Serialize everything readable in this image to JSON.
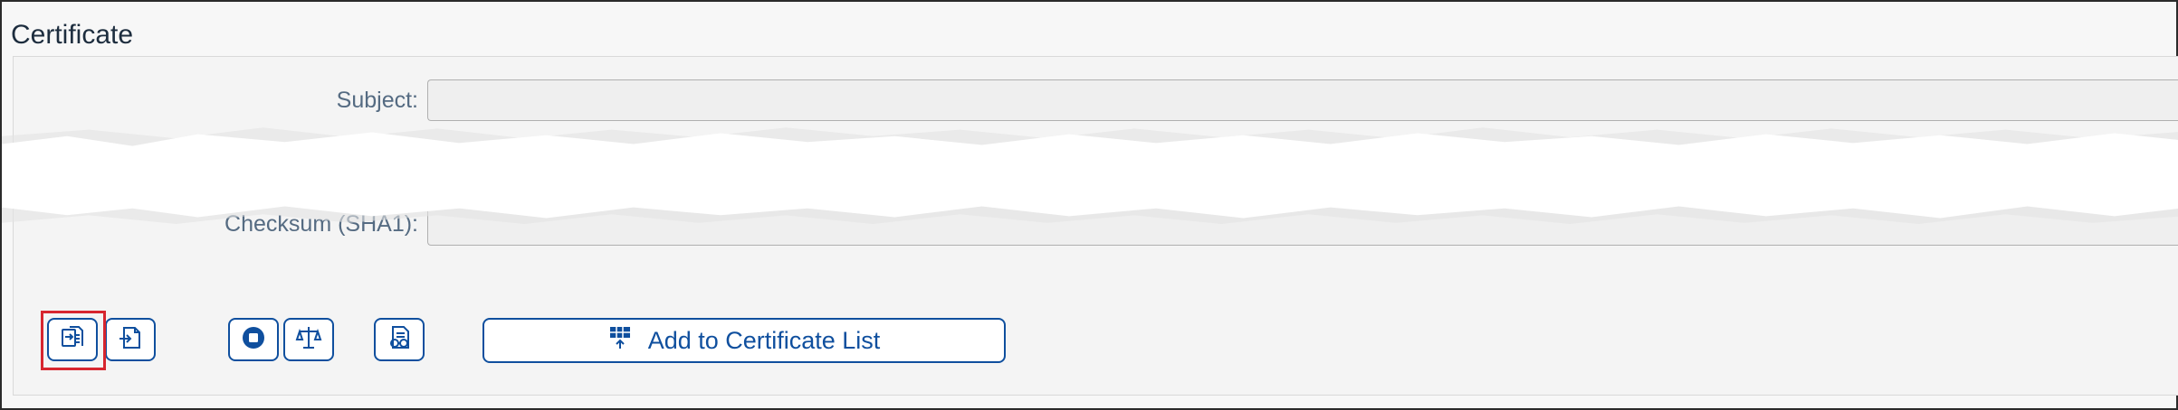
{
  "section": {
    "title": "Certificate"
  },
  "fields": {
    "subject_label": "Subject:",
    "subject_value": "",
    "checksum_label": "Checksum (SHA1):",
    "checksum_value": ""
  },
  "toolbar": {
    "add_to_certificate_list_label": "Add to Certificate List",
    "icons": [
      "import-certificate-icon",
      "export-certificate-icon",
      "stop-icon",
      "compare-scales-icon",
      "view-certificate-icon",
      "certificate-list-icon"
    ]
  },
  "colors": {
    "button_border": "#0f4f9e",
    "icon_color": "#0f4f9e",
    "highlight": "#d7262f",
    "label_color": "#556b82"
  }
}
